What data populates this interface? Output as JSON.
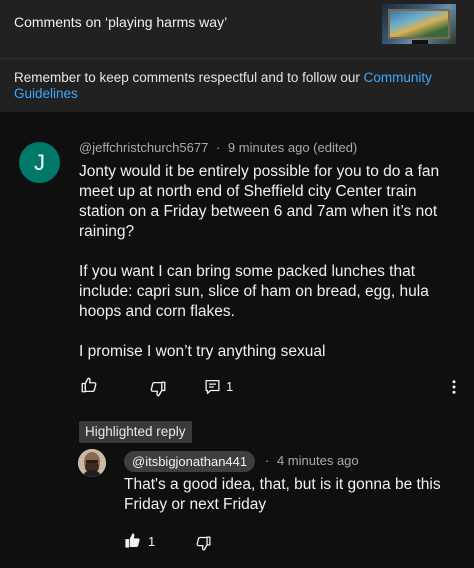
{
  "header": {
    "title": "Comments on ‘playing harms way’"
  },
  "guidelines": {
    "text": "Remember to keep comments respectful and to follow our ",
    "link": "Community Guidelines"
  },
  "comment": {
    "avatar_letter": "J",
    "author": "@jeffchristchurch5677",
    "separator": "·",
    "time": "9 minutes ago (edited)",
    "paragraphs": [
      "Jonty would it be entirely possible for you to do a fan meet up at north end of Sheffield city Center train station on a Friday between 6 and 7am when it’s not raining?",
      "If you want I can bring some packed lunches that include: capri sun, slice of ham on bread, egg, hula hoops and corn flakes.",
      "I promise I won’t try anything sexual"
    ],
    "reply_count": "1",
    "icons": [
      "thumbs-up-icon",
      "thumbs-down-icon",
      "reply-icon",
      "more-vert-icon"
    ]
  },
  "highlighted_label": "Highlighted reply",
  "reply": {
    "author": "@itsbigjonathan441",
    "separator": "·",
    "time": "4 minutes ago",
    "text": "That's a good idea, that, but is it gonna be this Friday or next Friday",
    "like_count": "1",
    "icons": [
      "thumbs-up-filled-icon",
      "thumbs-down-icon"
    ]
  },
  "colors": {
    "background": "#0f0f0f",
    "header_bg": "#212121",
    "link": "#3ea6ff",
    "avatar_bg": "#00796b",
    "meta_text": "#aaaaaa"
  }
}
